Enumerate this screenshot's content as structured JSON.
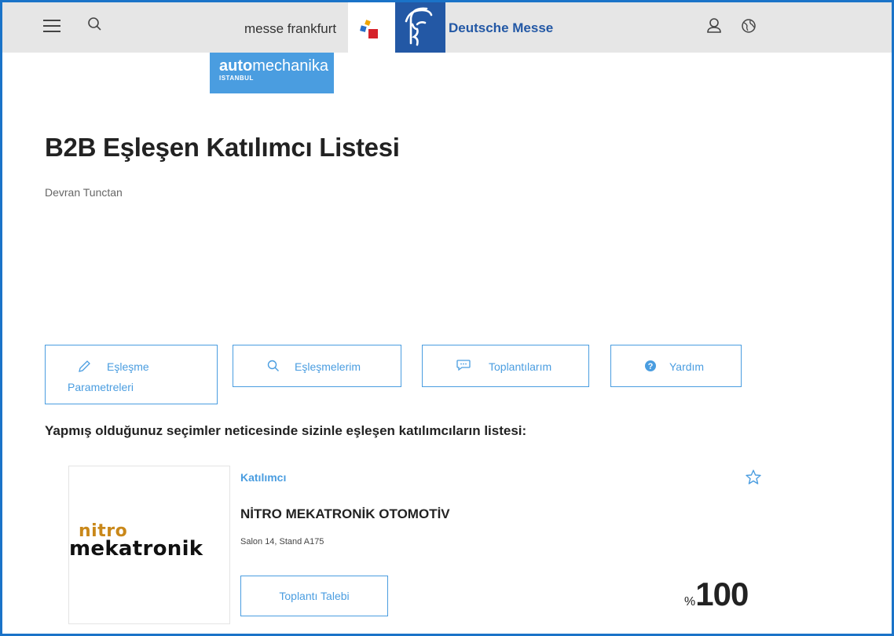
{
  "header": {
    "messe_frankfurt_label": "messe frankfurt",
    "deutsche_messe_label": "Deutsche Messe"
  },
  "event": {
    "name_bold": "auto",
    "name_rest": "mechanika",
    "city": "ISTANBUL"
  },
  "page": {
    "title": "B2B Eşleşen Katılımcı Listesi",
    "user_name": "Devran Tunctan"
  },
  "actions": {
    "params_line1": "Eşleşme",
    "params_line2": "Parametreleri",
    "matches": "Eşleşmelerim",
    "meetings": "Toplantılarım",
    "help": "Yardım"
  },
  "list": {
    "heading": "Yapmış olduğunuz seçimler neticesinde sizinle eşleşen katılımcıların listesi:"
  },
  "results": [
    {
      "type": "Katılımcı",
      "company": "NİTRO MEKATRONİK OTOMOTİV",
      "location": "Salon 14, Stand A175",
      "logo_line1": "nitro",
      "logo_line2": "mekatronik",
      "meeting_button": "Toplantı Talebi",
      "score_prefix": "%",
      "score": "100"
    }
  ],
  "colors": {
    "accent": "#4a9de0",
    "deutsche_messe_blue": "#2358a5",
    "topbar": "#e6e6e6"
  },
  "icons": [
    "menu-icon",
    "search-icon",
    "user-icon",
    "globe-icon",
    "pencil-icon",
    "search-icon",
    "chat-icon",
    "question-icon",
    "star-icon"
  ]
}
